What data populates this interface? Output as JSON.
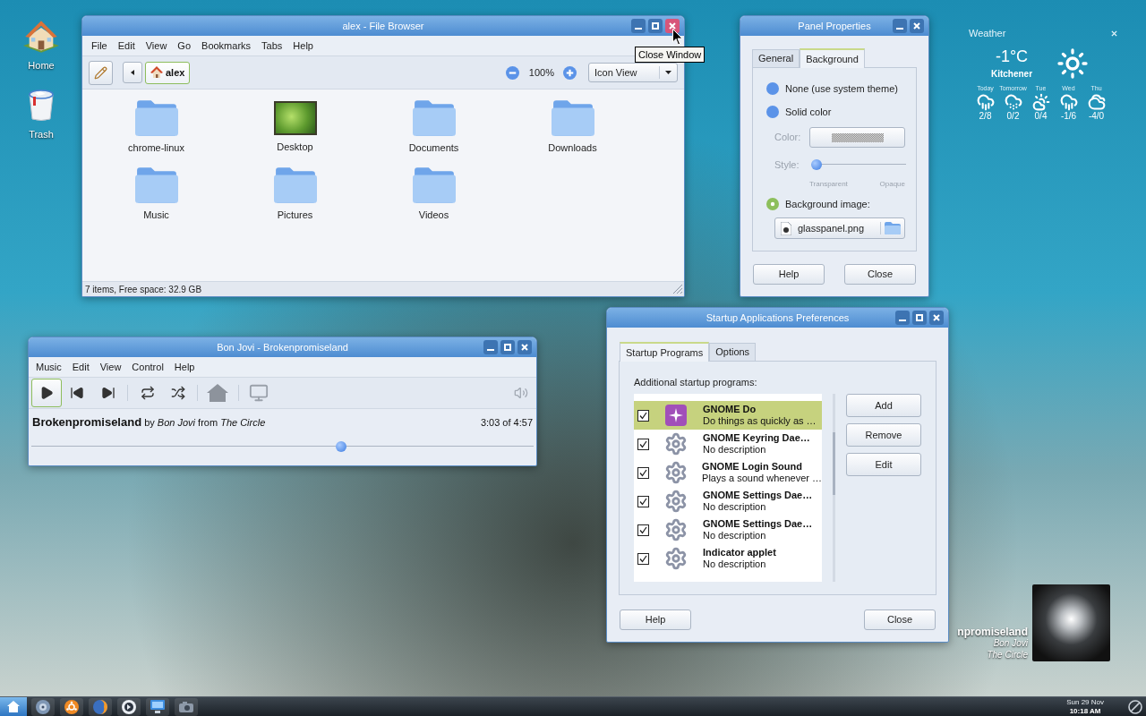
{
  "desktop_icons": [
    {
      "label": "Home",
      "kind": "home"
    },
    {
      "label": "Trash",
      "kind": "trash"
    }
  ],
  "file_browser": {
    "title": "alex - File Browser",
    "close_hovered": true,
    "menu": [
      "File",
      "Edit",
      "View",
      "Go",
      "Bookmarks",
      "Tabs",
      "Help"
    ],
    "location": "alex",
    "zoom": "100%",
    "view_mode": "Icon View",
    "items": [
      {
        "name": "chrome-linux",
        "kind": "folder"
      },
      {
        "name": "Desktop",
        "kind": "image"
      },
      {
        "name": "Documents",
        "kind": "folder"
      },
      {
        "name": "Downloads",
        "kind": "folder"
      },
      {
        "name": "Music",
        "kind": "folder"
      },
      {
        "name": "Pictures",
        "kind": "folder"
      },
      {
        "name": "Videos",
        "kind": "folder"
      }
    ],
    "status": "7 items, Free space: 32.9 GB"
  },
  "tooltip": "Close Window",
  "panel_properties": {
    "title": "Panel Properties",
    "tabs": [
      {
        "label": "General",
        "selected": false
      },
      {
        "label": "Background",
        "selected": true
      }
    ],
    "options": [
      {
        "label": "None (use system theme)",
        "selected": false
      },
      {
        "label": "Solid color",
        "selected": false
      },
      {
        "label": "Background image:",
        "selected": true
      }
    ],
    "color": {
      "label": "Color:",
      "disabled": true
    },
    "style": {
      "label": "Style:",
      "disabled": true,
      "level": 0,
      "min_label": "Transparent",
      "max_label": "Opaque"
    },
    "image_file": "glasspanel.png",
    "buttons": [
      "Help",
      "Close"
    ]
  },
  "weather": {
    "title": "Weather",
    "temperature": "-1°C",
    "location": "Kitchener",
    "forecast": [
      {
        "day": "Today",
        "range": "2/8",
        "kind": "rain"
      },
      {
        "day": "Tomorrow",
        "range": "0/2",
        "kind": "snow"
      },
      {
        "day": "Tue",
        "range": "0/4",
        "kind": "partly-cloudy"
      },
      {
        "day": "Wed",
        "range": "-1/6",
        "kind": "rain"
      },
      {
        "day": "Thu",
        "range": "-4/0",
        "kind": "cloudy"
      }
    ]
  },
  "music_player": {
    "title": "Bon Jovi - Brokenpromiseland",
    "menu": [
      "Music",
      "Edit",
      "View",
      "Control",
      "Help"
    ],
    "track": "**Brokenpromiseland** by *Bon Jovi* from *The Circle*",
    "time": "3:03 of 4:57",
    "position": {
      "level": 0.62
    }
  },
  "startup_apps": {
    "title": "Startup Applications Preferences",
    "tabs": [
      {
        "label": "Startup Programs",
        "selected": true
      },
      {
        "label": "Options",
        "selected": false
      }
    ],
    "list_label": "Additional startup programs:",
    "programs": [
      {
        "name": "GNOME Do",
        "description": "Do things as quickly as …",
        "checked": true,
        "selected": true,
        "kind": "app"
      },
      {
        "name": "GNOME Keyring Dae…",
        "description": "No description",
        "checked": true,
        "selected": false,
        "kind": "gear"
      },
      {
        "name": "GNOME Login Sound",
        "description": "Plays a sound whenever …",
        "checked": true,
        "selected": false,
        "kind": "gear"
      },
      {
        "name": "GNOME Settings Dae…",
        "description": "No description",
        "checked": true,
        "selected": false,
        "kind": "gear"
      },
      {
        "name": "GNOME Settings Dae…",
        "description": "No description",
        "checked": true,
        "selected": false,
        "kind": "gear"
      },
      {
        "name": "Indicator applet",
        "description": "No description",
        "checked": true,
        "selected": false,
        "kind": "gear"
      }
    ],
    "side_buttons": [
      "Add",
      "Remove",
      "Edit"
    ],
    "buttons": [
      "Help",
      "Close"
    ]
  },
  "now_playing": {
    "title": "npromiseland",
    "artist": "Bon Jovi",
    "album": "The Circle"
  },
  "clock": {
    "date": "Sun 29 Nov",
    "time": "10:18 AM"
  }
}
